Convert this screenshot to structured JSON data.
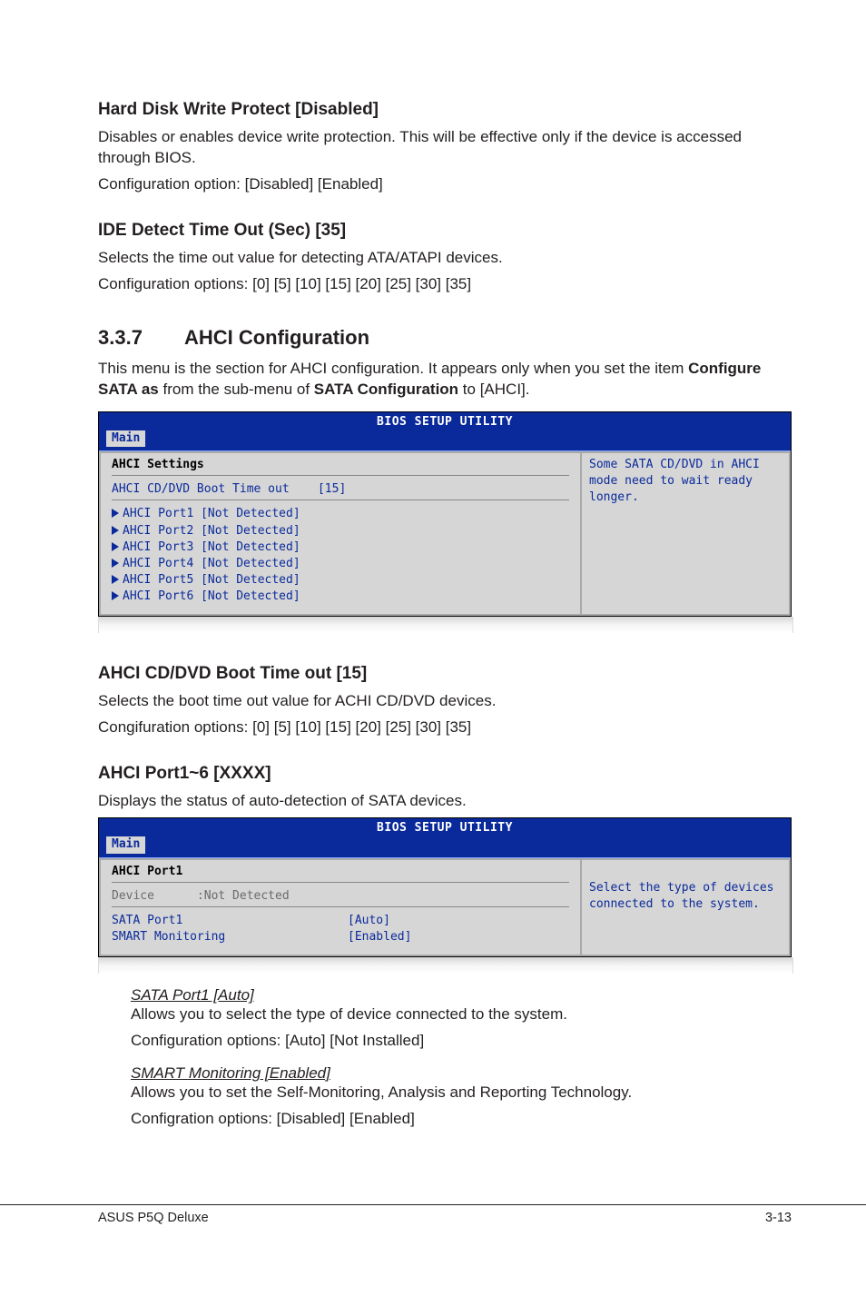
{
  "hardDisk": {
    "heading": "Hard Disk Write Protect [Disabled]",
    "p1": "Disables or enables device write protection. This will be effective only if the device is accessed through BIOS.",
    "p2": "Configuration option: [Disabled] [Enabled]"
  },
  "ideDetect": {
    "heading": "IDE Detect Time Out (Sec) [35]",
    "p1": "Selects the time out value for detecting ATA/ATAPI devices.",
    "p2": "Configuration options: [0] [5] [10] [15] [20] [25] [30] [35]"
  },
  "sectionNum": "3.3.7",
  "sectionTitle": "AHCI Configuration",
  "sectionIntro_a": "This menu is the section for AHCI configuration. It appears only when you set the item ",
  "sectionIntro_b": "Configure SATA as",
  "sectionIntro_c": " from the sub-menu of ",
  "sectionIntro_d": "SATA Configuration",
  "sectionIntro_e": " to [AHCI].",
  "bios1": {
    "title": "BIOS SETUP UTILITY",
    "tab": "Main",
    "leftTitle": "AHCI Settings",
    "bootLine": "AHCI CD/DVD Boot Time out    [15]",
    "ports": [
      "AHCI Port1 [Not Detected]",
      "AHCI Port2 [Not Detected]",
      "AHCI Port3 [Not Detected]",
      "AHCI Port4 [Not Detected]",
      "AHCI Port5 [Not Detected]",
      "AHCI Port6 [Not Detected]"
    ],
    "help": "Some SATA CD/DVD in AHCI mode need to wait ready longer."
  },
  "ahciBoot": {
    "heading": "AHCI CD/DVD Boot Time out [15]",
    "p1": "Selects the boot time out value for ACHI CD/DVD devices.",
    "p2": "Congifuration options: [0] [5] [10] [15] [20] [25] [30] [35]"
  },
  "ahciPort": {
    "heading": "AHCI Port1~6 [XXXX]",
    "p1": "Displays the status of auto-detection of SATA devices."
  },
  "bios2": {
    "title": "BIOS SETUP UTILITY",
    "tab": "Main",
    "leftTitle": "AHCI Port1",
    "deviceLine": "Device      :Not Detected",
    "row1l": "SATA Port1",
    "row1r": "[Auto]",
    "row2l": "SMART Monitoring",
    "row2r": "[Enabled]",
    "help": "Select the type of devices connected to the system."
  },
  "sataPort1": {
    "title": "SATA Port1 [Auto]",
    "p1": "Allows you to select the type of device connected to the system.",
    "p2": "Configuration options: [Auto] [Not Installed]"
  },
  "smart": {
    "title": "SMART Monitoring [Enabled]",
    "p1": "Allows you to set the Self-Monitoring, Analysis and Reporting Technology.",
    "p2": "Configration options: [Disabled] [Enabled]"
  },
  "footerLeft": "ASUS P5Q Deluxe",
  "footerRight": "3-13"
}
